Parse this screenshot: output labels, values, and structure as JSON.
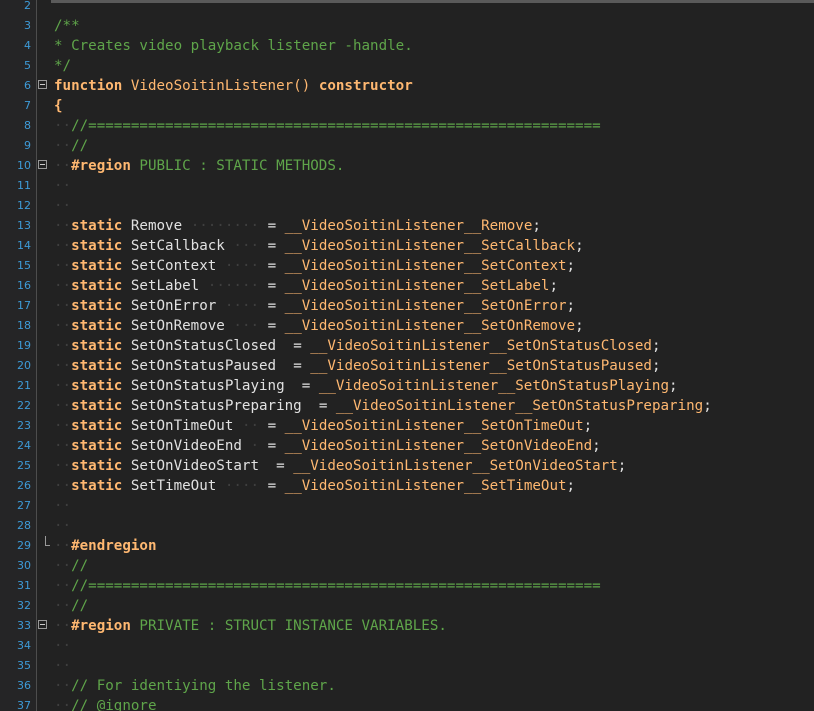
{
  "editor": {
    "lines": [
      {
        "n": "2",
        "text": ""
      },
      {
        "n": "3",
        "text": "/**"
      },
      {
        "n": "4",
        "text": "* Creates video playback listener -handle."
      },
      {
        "n": "5",
        "text": "*/"
      },
      {
        "n": "6",
        "text": "function VideoSoitinListener() constructor"
      },
      {
        "n": "7",
        "text": "{"
      },
      {
        "n": "8",
        "text": "//============================================================"
      },
      {
        "n": "9",
        "text": "//"
      },
      {
        "n": "10",
        "text": "#region PUBLIC : STATIC METHODS."
      },
      {
        "n": "11",
        "text": ""
      },
      {
        "n": "12",
        "text": ""
      },
      {
        "n": "13",
        "text": "static Remove = __VideoSoitinListener__Remove;"
      },
      {
        "n": "14",
        "text": "static SetCallback = __VideoSoitinListener__SetCallback;"
      },
      {
        "n": "15",
        "text": "static SetContext = __VideoSoitinListener__SetContext;"
      },
      {
        "n": "16",
        "text": "static SetLabel = __VideoSoitinListener__SetLabel;"
      },
      {
        "n": "17",
        "text": "static SetOnError = __VideoSoitinListener__SetOnError;"
      },
      {
        "n": "18",
        "text": "static SetOnRemove = __VideoSoitinListener__SetOnRemove;"
      },
      {
        "n": "19",
        "text": "static SetOnStatusClosed = __VideoSoitinListener__SetOnStatusClosed;"
      },
      {
        "n": "20",
        "text": "static SetOnStatusPaused = __VideoSoitinListener__SetOnStatusPaused;"
      },
      {
        "n": "21",
        "text": "static SetOnStatusPlaying = __VideoSoitinListener__SetOnStatusPlaying;"
      },
      {
        "n": "22",
        "text": "static SetOnStatusPreparing = __VideoSoitinListener__SetOnStatusPreparing;"
      },
      {
        "n": "23",
        "text": "static SetOnTimeOut = __VideoSoitinListener__SetOnTimeOut;"
      },
      {
        "n": "24",
        "text": "static SetOnVideoEnd = __VideoSoitinListener__SetOnVideoEnd;"
      },
      {
        "n": "25",
        "text": "static SetOnVideoStart = __VideoSoitinListener__SetOnVideoStart;"
      },
      {
        "n": "26",
        "text": "static SetTimeOut = __VideoSoitinListener__SetTimeOut;"
      },
      {
        "n": "27",
        "text": ""
      },
      {
        "n": "28",
        "text": ""
      },
      {
        "n": "29",
        "text": "#endregion"
      },
      {
        "n": "30",
        "text": "//"
      },
      {
        "n": "31",
        "text": "//============================================================"
      },
      {
        "n": "32",
        "text": "//"
      },
      {
        "n": "33",
        "text": "#region PRIVATE : STRUCT INSTANCE VARIABLES."
      },
      {
        "n": "34",
        "text": ""
      },
      {
        "n": "35",
        "text": ""
      },
      {
        "n": "36",
        "text": "// For identiying the listener."
      },
      {
        "n": "37",
        "text": "// @ignore"
      }
    ]
  },
  "colors": {
    "background": "#222222",
    "gutter": "#252526",
    "line_number": "#3d9bd8",
    "comment": "#5fa54a",
    "keyword": "#ffb871",
    "identifier": "#e1e1e1",
    "whitespace_dot": "#3f3f3f"
  },
  "icons": {
    "fold_open": "fold-minus-icon",
    "fold_end": "fold-end-icon"
  }
}
